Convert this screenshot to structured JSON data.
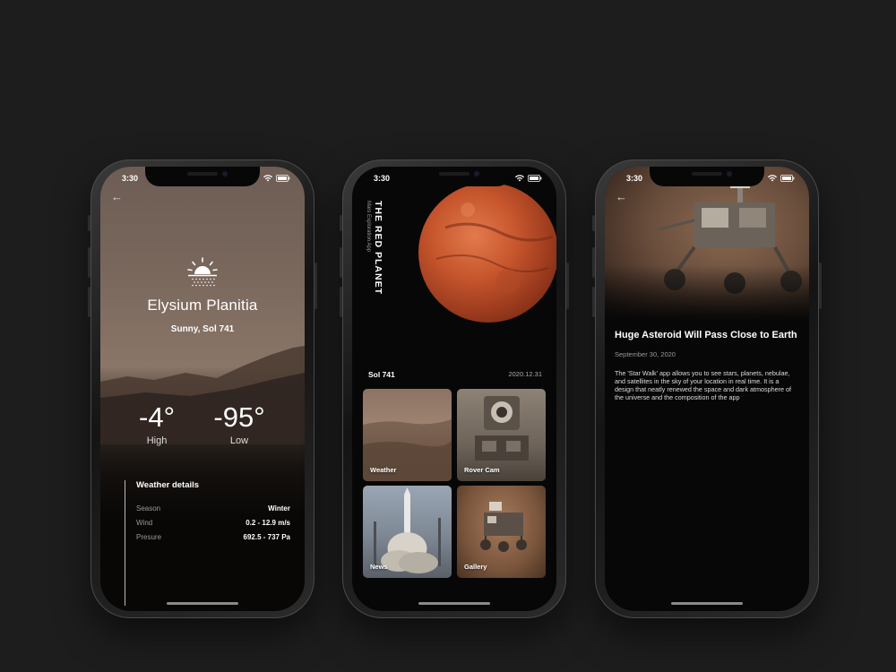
{
  "status": {
    "time": "3:30"
  },
  "weather": {
    "location": "Elysium Planitia",
    "condition": "Sunny, Sol 741",
    "high": {
      "value": "-4°",
      "label": "High"
    },
    "low": {
      "value": "-95°",
      "label": "Low"
    },
    "details_title": "Weather details",
    "details": [
      {
        "key": "Season",
        "value": "Winter"
      },
      {
        "key": "Wind",
        "value": "0.2 - 12.9 m/s"
      },
      {
        "key": "Presure",
        "value": "692.5 - 737 Pa"
      }
    ]
  },
  "home": {
    "title": "THE RED PLANET",
    "subtitle": "Mars Exploration App",
    "sol": "Sol 741",
    "date": "2020.12.31",
    "tiles": [
      {
        "label": "Weather"
      },
      {
        "label": "Rover Cam"
      },
      {
        "label": "News"
      },
      {
        "label": "Gallery"
      }
    ]
  },
  "article": {
    "title": "Huge Asteroid Will Pass Close to Earth",
    "date": "September 30, 2020",
    "body": "The 'Star Walk' app allows you to see stars, planets, nebulae, and satellites in the sky of your location in real time. It is a design that neatly renewed the space and dark atmosphere of the universe and the composition of the app"
  },
  "colors": {
    "background": "#1d1d1d",
    "mars": "#c7562d",
    "accent_text": "#ffffff"
  }
}
